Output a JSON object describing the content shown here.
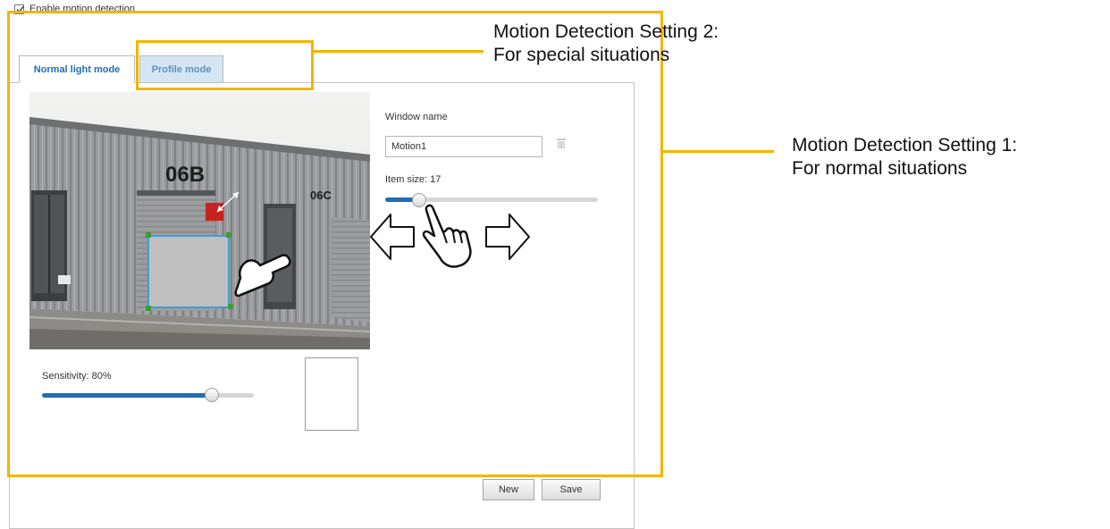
{
  "motion_detection": {
    "enable_label": "Enable motion detection",
    "enabled": true
  },
  "tabs": [
    {
      "label": "Normal light mode",
      "active": true
    },
    {
      "label": "Profile mode",
      "active": false
    }
  ],
  "window": {
    "name_label": "Window name",
    "name_value": "Motion1",
    "item_size_label": "Item size: 17",
    "item_size_value": 17,
    "item_size_fraction": 0.16
  },
  "sensitivity": {
    "label": "Sensitivity: 80%",
    "value_percent": 80
  },
  "buttons": {
    "new": "New",
    "save": "Save"
  },
  "camera": {
    "building_labels": [
      "06B",
      "06C"
    ]
  },
  "annotations": {
    "setting2_line1": "Motion Detection Setting 2:",
    "setting2_line2": "For special situations",
    "setting1_line1": "Motion Detection Setting 1:",
    "setting1_line2": "For normal situations"
  },
  "icons": [
    "checkbox-check-icon",
    "trash-icon",
    "arrow-left-icon",
    "arrow-right-icon",
    "hand-pointer-icon",
    "resize-arrow-icon"
  ],
  "colors": {
    "highlight": "#f5b400",
    "slider_fill": "#1f6db3",
    "tab_active_text": "#1d6fb8",
    "tab_inactive_bg": "#d4e6f3",
    "motion_window_border": "#3aa0d8",
    "motion_window_handles": "#3c9a3c",
    "motion_window_marker": "#c8221e"
  }
}
